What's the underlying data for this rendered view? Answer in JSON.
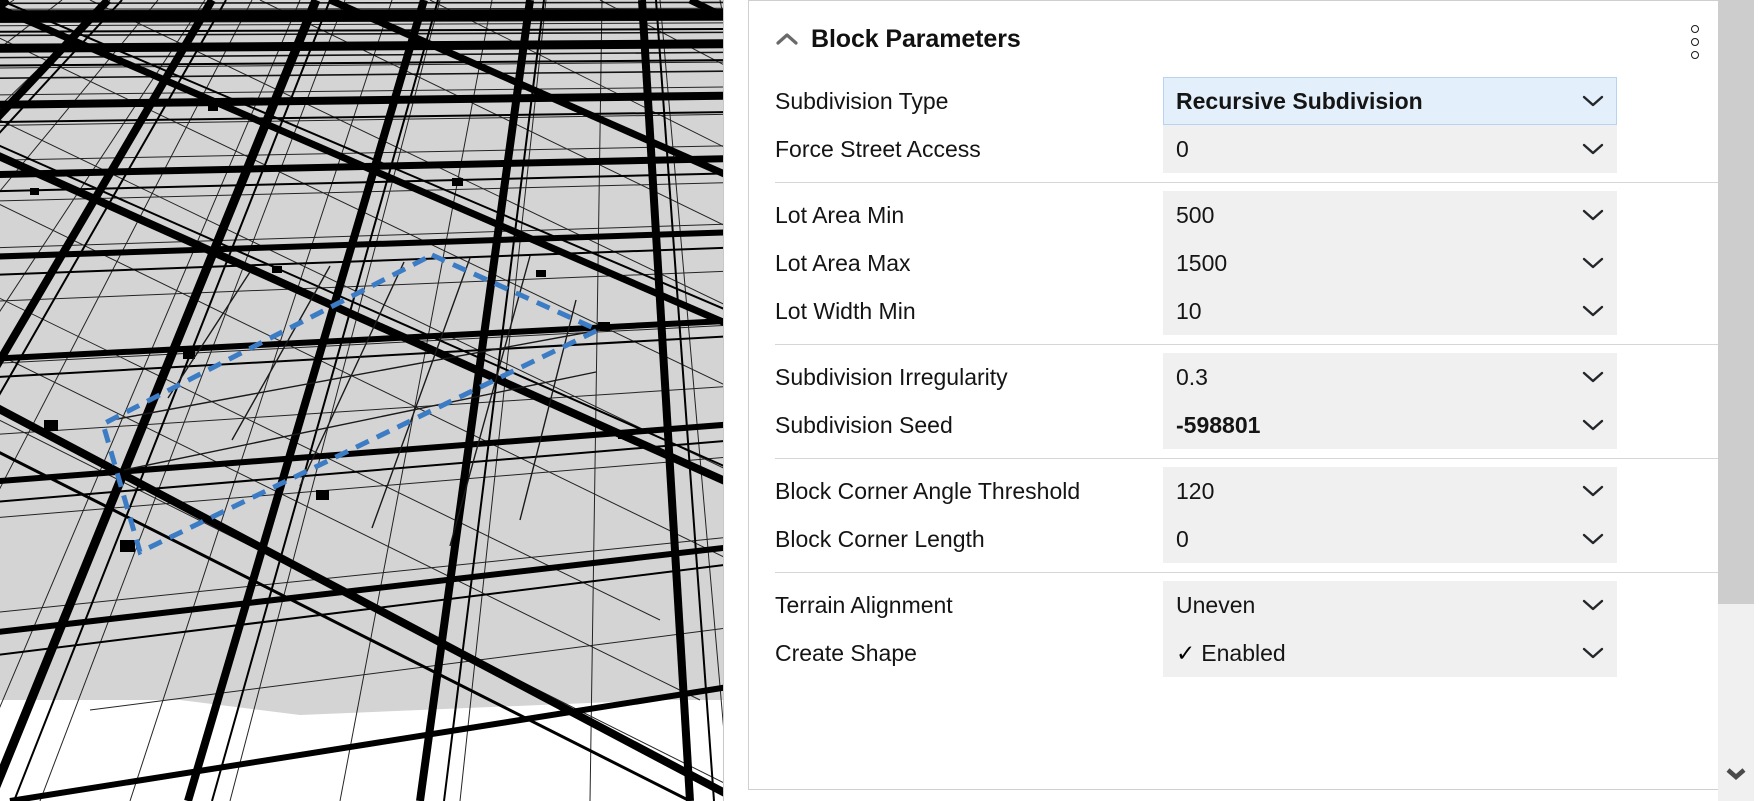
{
  "viewport": {
    "name": "3D City Model Viewport",
    "selection_outline_color": "#3b7cc4",
    "ground_fill": "#d4d4d4",
    "street_color": "#000000",
    "background": "#ffffff"
  },
  "panel": {
    "title": "Block Parameters",
    "collapse_icon": "chevron-up-icon",
    "overflow_icon": "kebab-menu-icon",
    "highlight_color": "#e3effb",
    "field_color": "#f0f0f0",
    "groups": [
      {
        "rows": [
          {
            "label": "Subdivision Type",
            "value": "Recursive Subdivision",
            "selected": true,
            "bold": true,
            "checked": false
          },
          {
            "label": "Force Street Access",
            "value": "0",
            "selected": false,
            "bold": false,
            "checked": false
          }
        ]
      },
      {
        "rows": [
          {
            "label": "Lot Area Min",
            "value": "500",
            "selected": false,
            "bold": false,
            "checked": false
          },
          {
            "label": "Lot Area Max",
            "value": "1500",
            "selected": false,
            "bold": false,
            "checked": false
          },
          {
            "label": "Lot Width Min",
            "value": "10",
            "selected": false,
            "bold": false,
            "checked": false
          }
        ]
      },
      {
        "rows": [
          {
            "label": "Subdivision Irregularity",
            "value": "0.3",
            "selected": false,
            "bold": false,
            "checked": false
          },
          {
            "label": "Subdivision Seed",
            "value": "-598801",
            "selected": false,
            "bold": true,
            "checked": false
          }
        ]
      },
      {
        "rows": [
          {
            "label": "Block Corner Angle Threshold",
            "value": "120",
            "selected": false,
            "bold": false,
            "checked": false
          },
          {
            "label": "Block Corner Length",
            "value": "0",
            "selected": false,
            "bold": false,
            "checked": false
          }
        ]
      },
      {
        "rows": [
          {
            "label": "Terrain Alignment",
            "value": "Uneven",
            "selected": false,
            "bold": false,
            "checked": false
          },
          {
            "label": "Create Shape",
            "value": "Enabled",
            "selected": false,
            "bold": false,
            "checked": true
          }
        ]
      }
    ]
  },
  "scrollbar": {
    "name": "vertical-scrollbar",
    "down_icon": "chevron-down-icon",
    "thumb_color": "#cdcdcd",
    "track_color": "#f0f0f0"
  }
}
